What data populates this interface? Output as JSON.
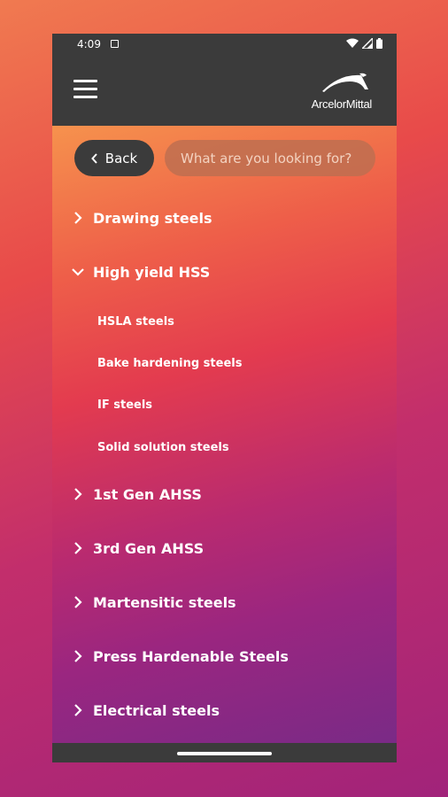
{
  "status": {
    "time": "4:09"
  },
  "brand": {
    "name": "ArcelorMittal"
  },
  "toolbar": {
    "back_label": "Back",
    "search_placeholder": "What are you looking for?"
  },
  "categories": [
    {
      "label": "Drawing steels",
      "expanded": false
    },
    {
      "label": "High yield HSS",
      "expanded": true,
      "children": [
        "HSLA steels",
        "Bake hardening steels",
        "IF steels",
        "Solid solution steels"
      ]
    },
    {
      "label": "1st Gen AHSS",
      "expanded": false
    },
    {
      "label": "3rd Gen AHSS",
      "expanded": false
    },
    {
      "label": "Martensitic steels",
      "expanded": false
    },
    {
      "label": "Press Hardenable Steels",
      "expanded": false
    },
    {
      "label": "Electrical steels",
      "expanded": false
    }
  ],
  "icons": {
    "menu": "hamburger-icon",
    "back": "chevron-left-icon",
    "collapsed": "chevron-right-icon",
    "expanded": "chevron-down-icon",
    "wifi": "wifi-icon",
    "signal": "signal-icon",
    "battery": "battery-icon",
    "notification": "notification-icon"
  },
  "colors": {
    "bar": "#3b3b3b",
    "text": "#ffffff",
    "accent": "#f6924d"
  }
}
